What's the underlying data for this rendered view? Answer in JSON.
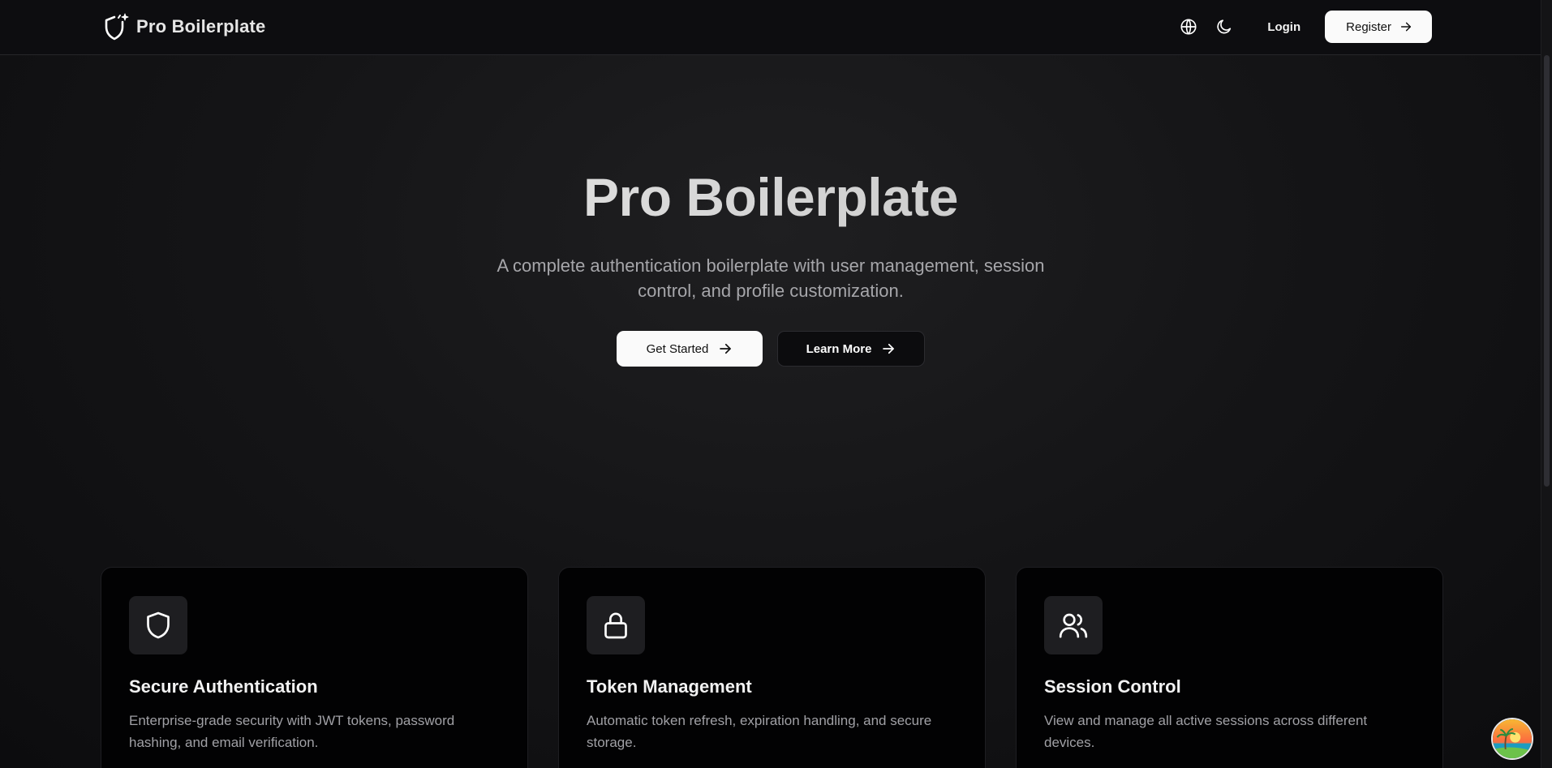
{
  "header": {
    "brand_name": "Pro Boilerplate",
    "nav": {
      "login_label": "Login",
      "register_label": "Register"
    },
    "icons": [
      "shield-sparkle-icon",
      "globe-icon",
      "moon-icon",
      "arrow-right-icon"
    ]
  },
  "hero": {
    "title": "Pro Boilerplate",
    "subtitle": "A complete authentication boilerplate with user management, session control, and profile customization.",
    "primary_button": "Get Started",
    "secondary_button": "Learn More"
  },
  "features": [
    {
      "icon": "shield-icon",
      "title": "Secure Authentication",
      "description": "Enterprise-grade security with JWT tokens, password hashing, and email verification."
    },
    {
      "icon": "lock-icon",
      "title": "Token Management",
      "description": "Automatic token refresh, expiration handling, and secure storage."
    },
    {
      "icon": "users-icon",
      "title": "Session Control",
      "description": "View and manage all active sessions across different devices."
    }
  ],
  "colors": {
    "background": "#0b0b0d",
    "card_background": "#020203",
    "button_light": "#fafafa",
    "muted_text": "#a6a6aa"
  }
}
